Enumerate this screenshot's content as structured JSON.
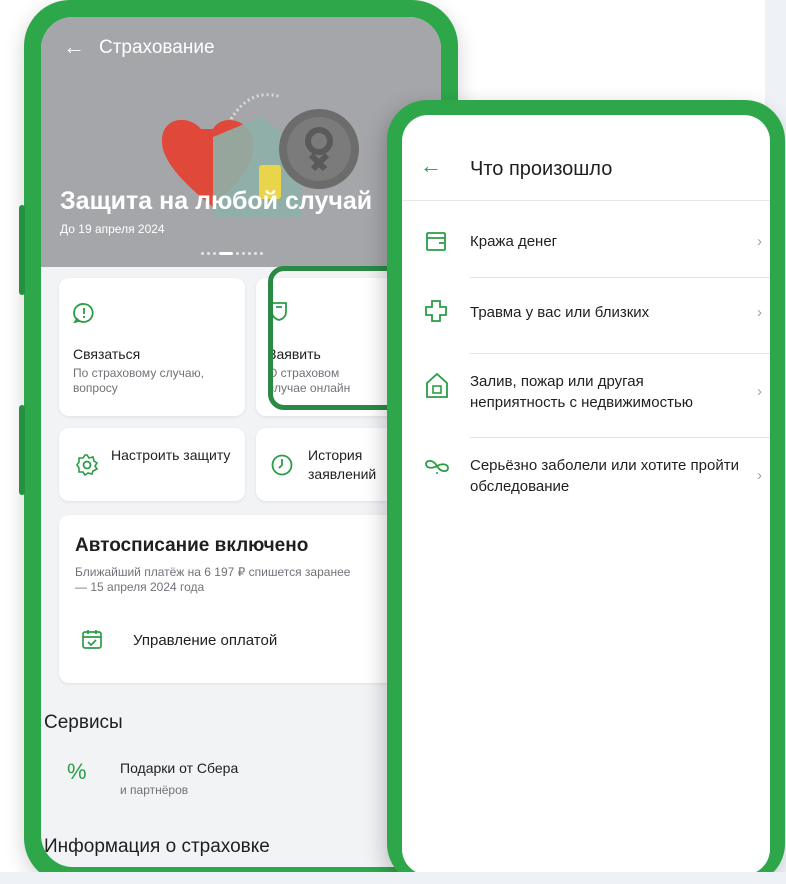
{
  "left_screen": {
    "title": "Страхование",
    "hero_headline": "Защита на любой случай",
    "hero_date": "До 19 апреля 2024",
    "cards": {
      "contact": {
        "label": "Связаться",
        "sub": "По страховому случаю, вопросу"
      },
      "claim": {
        "label": "Заявить",
        "sub": "О страховом случае онлайн"
      },
      "settings": {
        "label": "Настроить защиту"
      },
      "history": {
        "label": "История заявлений"
      }
    },
    "autopay": {
      "title": "Автосписание включено",
      "sub": "Ближайший платёж на 6 197 ₽ спишется заранее — 15 апреля 2024 года",
      "manage_label": "Управление оплатой"
    },
    "services": {
      "title": "Сервисы",
      "gift_label": "Подарки от Сбера",
      "gift_sub": "и партнёров"
    },
    "info_title": "Информация о страховке"
  },
  "right_screen": {
    "title": "Что произошло",
    "items": [
      {
        "label": "Кража денег",
        "icon": "wallet-icon"
      },
      {
        "label": "Травма у вас или близких",
        "icon": "medical-cross-icon"
      },
      {
        "label": "Залив, пожар или другая неприятность с недвижимостью",
        "icon": "house-icon"
      },
      {
        "label": "Серьёзно заболели или хотите пройти обследование",
        "icon": "infinity-heart-icon"
      }
    ]
  },
  "colors": {
    "brand_green": "#2ea74b",
    "icon_green": "#2a9d47",
    "hero_gray": "#a5a6aa"
  }
}
